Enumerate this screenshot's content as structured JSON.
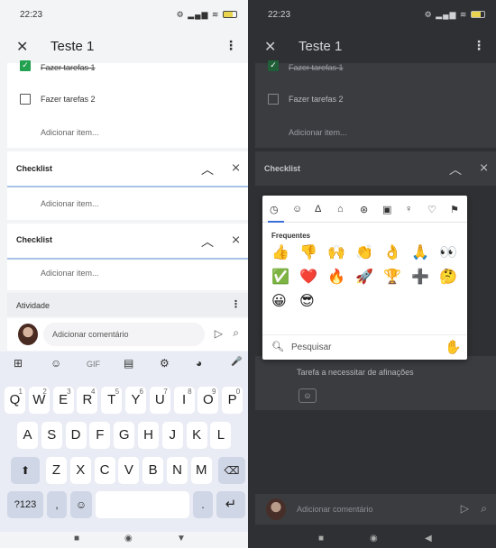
{
  "status": {
    "time": "22:23",
    "icons": "⚙ ▂▄▆ ≋"
  },
  "appbar": {
    "title": "Teste 1"
  },
  "tasks": [
    {
      "label": "Fazer tarefas 1",
      "checked": true
    },
    {
      "label": "Fazer tarefas 2",
      "checked": false
    }
  ],
  "add_item_label": "Adicionar item...",
  "checklists": [
    {
      "title": "Checklist",
      "add_label": "Adicionar item..."
    },
    {
      "title": "Checklist",
      "add_label": "Adicionar item..."
    }
  ],
  "activity": {
    "title": "Atividade"
  },
  "comment": {
    "placeholder": "Adicionar comentário"
  },
  "keyboard": {
    "toolbar": [
      "⊞",
      "☺",
      "GIF",
      "▤",
      "⚙",
      "◕",
      "🎤"
    ],
    "row1": [
      {
        "k": "Q",
        "n": "1"
      },
      {
        "k": "W",
        "n": "2"
      },
      {
        "k": "E",
        "n": "3"
      },
      {
        "k": "R",
        "n": "4"
      },
      {
        "k": "T",
        "n": "5"
      },
      {
        "k": "Y",
        "n": "6"
      },
      {
        "k": "U",
        "n": "7"
      },
      {
        "k": "I",
        "n": "8"
      },
      {
        "k": "O",
        "n": "9"
      },
      {
        "k": "P",
        "n": "0"
      }
    ],
    "row2": [
      "A",
      "S",
      "D",
      "F",
      "G",
      "H",
      "J",
      "K",
      "L"
    ],
    "row3": [
      "Z",
      "X",
      "C",
      "V",
      "B",
      "N",
      "M"
    ],
    "numbers_key": "?123",
    "comma": ",",
    "period": "."
  },
  "right": {
    "emoji_tabs": [
      "◷",
      "☺",
      "Δ",
      "⌂",
      "⊛",
      "▣",
      "♀",
      "♡",
      "⚑"
    ],
    "frequent_label": "Frequentes",
    "emojis": [
      "👍",
      "👎",
      "🙌",
      "👏",
      "👌",
      "🙏",
      "👀",
      "✅",
      "❤️",
      "🔥",
      "🚀",
      "🏆",
      "➕",
      "🤔",
      "😀",
      "😎"
    ],
    "search_placeholder": "Pesquisar",
    "skin_tone_emoji": "✋",
    "card_text": "Tarefa a necessitar de afinações"
  }
}
